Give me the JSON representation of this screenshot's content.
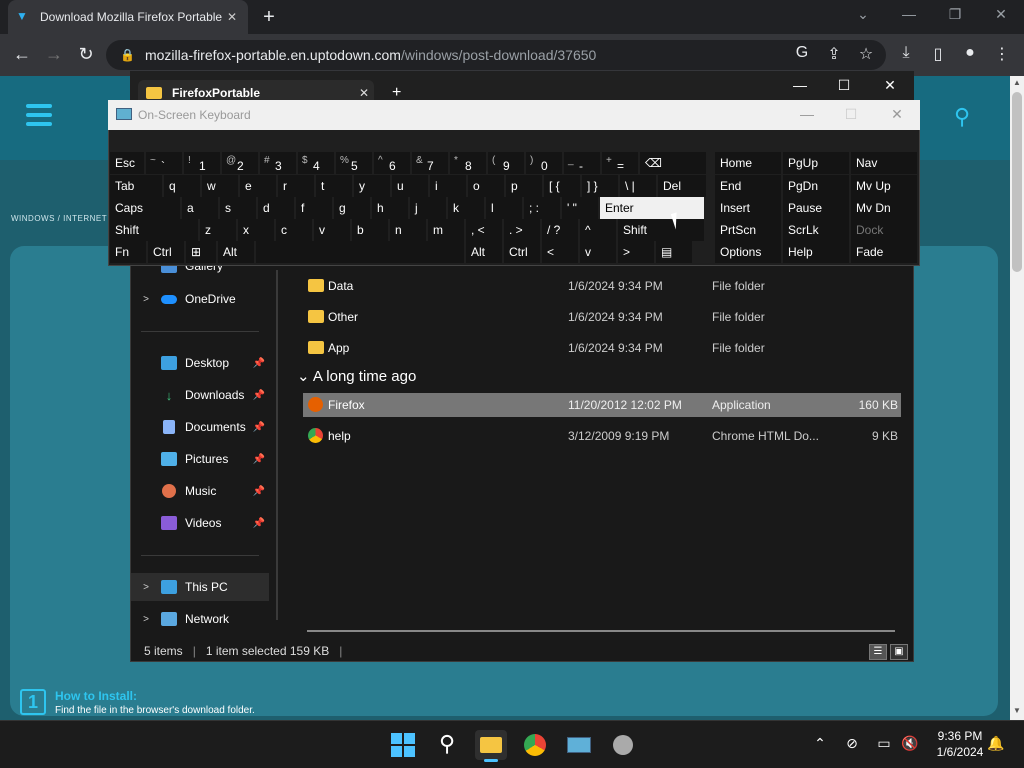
{
  "browser": {
    "tab_title": "Download Mozilla Firefox Portable",
    "url_host": "mozilla-firefox-portable.en.uptodown.com",
    "url_path": "/windows/post-download/37650"
  },
  "site": {
    "breadcrumbs": "WINDOWS   /   INTERNET",
    "step_number": "1",
    "step_title": "How to Install:",
    "step_desc": "Find the file in the browser's download folder."
  },
  "explorer": {
    "tab_title": "FirefoxPortable",
    "nav": {
      "gallery": "Gallery",
      "onedrive": "OneDrive",
      "desktop": "Desktop",
      "downloads": "Downloads",
      "documents": "Documents",
      "pictures": "Pictures",
      "music": "Music",
      "videos": "Videos",
      "thispc": "This PC",
      "network": "Network"
    },
    "rows": [
      {
        "name": "Data",
        "date": "1/6/2024 9:34 PM",
        "type": "File folder",
        "size": ""
      },
      {
        "name": "Other",
        "date": "1/6/2024 9:34 PM",
        "type": "File folder",
        "size": ""
      },
      {
        "name": "App",
        "date": "1/6/2024 9:34 PM",
        "type": "File folder",
        "size": ""
      }
    ],
    "group_header": "A long time ago",
    "rows2": [
      {
        "name": "Firefox",
        "date": "11/20/2012 12:02 PM",
        "type": "Application",
        "size": "160 KB"
      },
      {
        "name": "help",
        "date": "3/12/2009 9:19 PM",
        "type": "Chrome HTML Do...",
        "size": "9 KB"
      }
    ],
    "status": {
      "items": "5 items",
      "selected": "1 item selected  159 KB"
    }
  },
  "osk": {
    "title": "On-Screen Keyboard",
    "row1": [
      {
        "top": "",
        "bot": "Esc"
      },
      {
        "top": "~",
        "bot": "`"
      },
      {
        "top": "!",
        "bot": "1"
      },
      {
        "top": "@",
        "bot": "2"
      },
      {
        "top": "#",
        "bot": "3"
      },
      {
        "top": "$",
        "bot": "4"
      },
      {
        "top": "%",
        "bot": "5"
      },
      {
        "top": "^",
        "bot": "6"
      },
      {
        "top": "&",
        "bot": "7"
      },
      {
        "top": "*",
        "bot": "8"
      },
      {
        "top": "(",
        "bot": "9"
      },
      {
        "top": ")",
        "bot": "0"
      },
      {
        "top": "_",
        "bot": "-"
      },
      {
        "top": "+",
        "bot": "="
      },
      {
        "top": "",
        "bot": "⌫"
      }
    ],
    "row2": [
      "Tab",
      "q",
      "w",
      "e",
      "r",
      "t",
      "y",
      "u",
      "i",
      "o",
      "p",
      "[ {",
      "] }",
      "\\ |",
      "Del"
    ],
    "row3": [
      "Caps",
      "a",
      "s",
      "d",
      "f",
      "g",
      "h",
      "j",
      "k",
      "l",
      "; :",
      "' \"",
      "Enter"
    ],
    "row4": [
      "Shift",
      "z",
      "x",
      "c",
      "v",
      "b",
      "n",
      "m",
      ", <",
      ". >",
      "/ ?",
      "^",
      "Shift"
    ],
    "row5": [
      "Fn",
      "Ctrl",
      "⊞",
      "Alt",
      "",
      "Alt",
      "Ctrl",
      "<",
      "v",
      ">",
      "▤"
    ],
    "nav": [
      [
        "Home",
        "PgUp",
        "Nav"
      ],
      [
        "End",
        "PgDn",
        "Mv Up"
      ],
      [
        "Insert",
        "Pause",
        "Mv Dn"
      ],
      [
        "PrtScn",
        "ScrLk",
        "Dock"
      ],
      [
        "Options",
        "Help",
        "Fade"
      ]
    ]
  },
  "taskbar": {
    "time": "9:36 PM",
    "date": "1/6/2024"
  },
  "colors": {
    "chrome_bg": "#202124",
    "site_teal": "#1e5f6e",
    "accent_cyan": "#2ec5ef",
    "explorer_bg": "#191919",
    "selected_row": "#777777"
  }
}
